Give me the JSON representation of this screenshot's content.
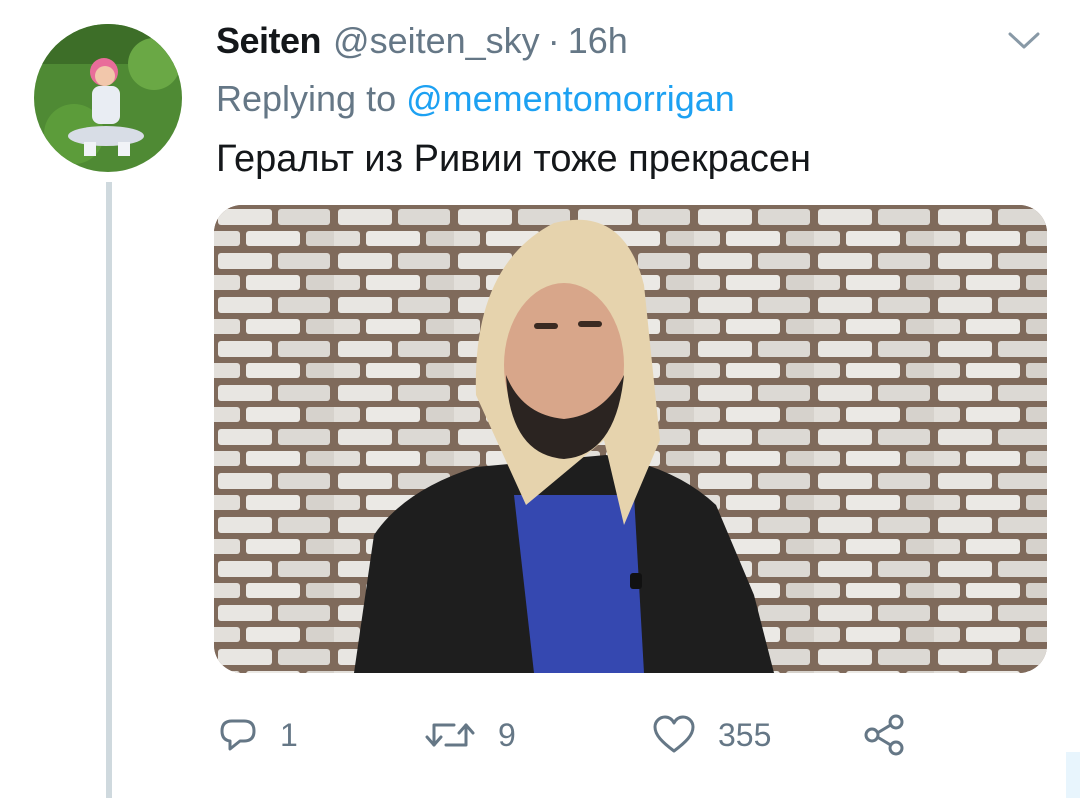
{
  "tweet": {
    "display_name": "Seiten",
    "handle": "@seiten_sky",
    "separator": "·",
    "time": "16h",
    "replying_prefix": "Replying to",
    "replying_to": "@mementomorrigan",
    "text": "Геральт из Ривии тоже прекрасен"
  },
  "actions": {
    "replies": "1",
    "retweets": "9",
    "likes": "355"
  },
  "icons": {
    "reply": "reply-icon",
    "retweet": "retweet-icon",
    "like": "heart-icon",
    "share": "share-icon",
    "menu": "chevron-down-icon"
  },
  "colors": {
    "name": "#14171a",
    "secondary": "#657786",
    "link": "#1da1f2",
    "thread_line": "#cfd9de"
  }
}
